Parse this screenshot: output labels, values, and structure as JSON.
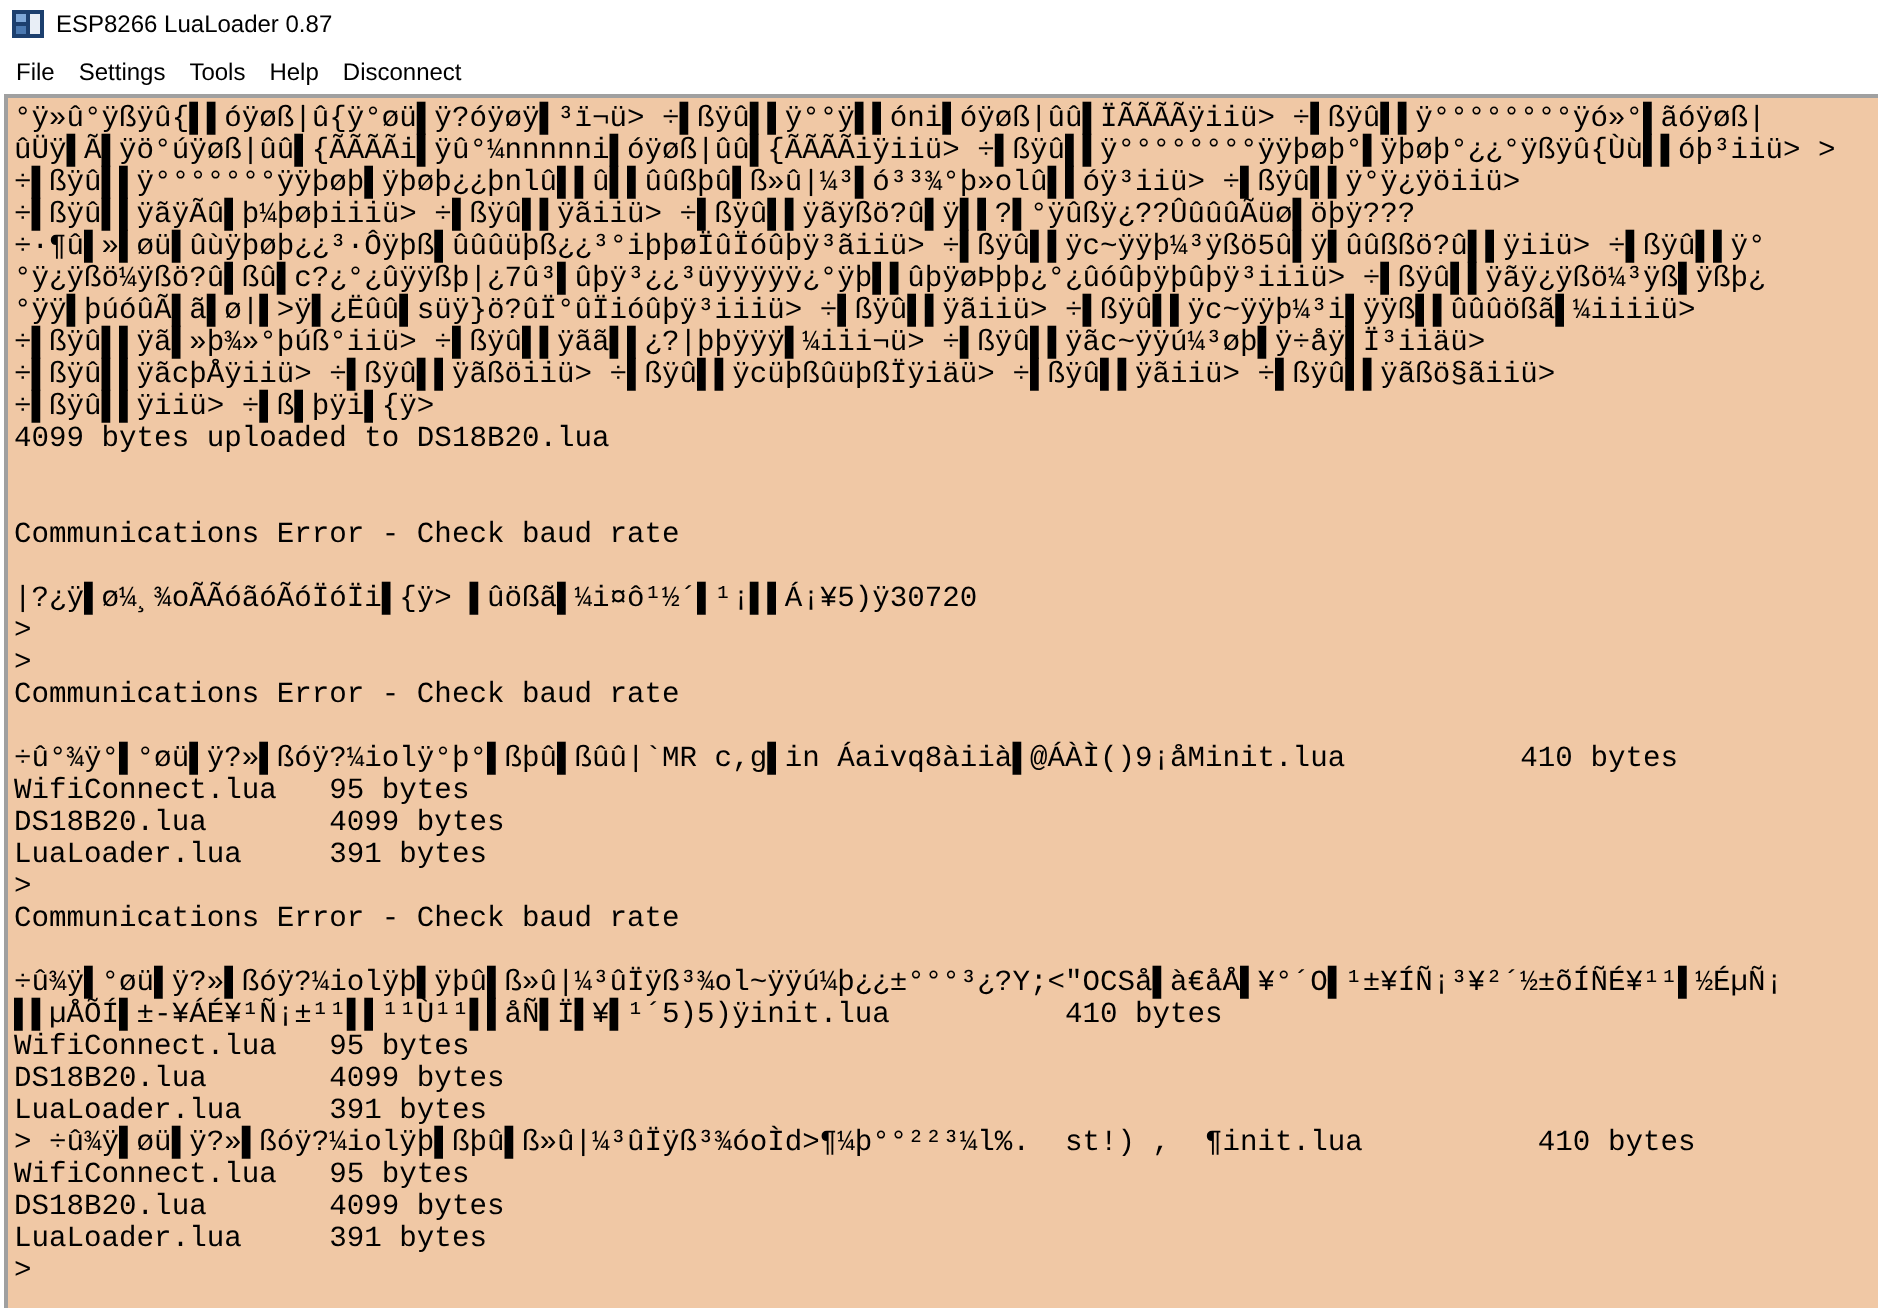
{
  "window": {
    "title": "ESP8266 LuaLoader 0.87"
  },
  "menu": [
    "File",
    "Settings",
    "Tools",
    "Help",
    "Disconnect"
  ],
  "console": {
    "lines": [
      {
        "kind": "text",
        "text": "°ÿ»û°ÿßÿû{▌▌óÿøß|û{ÿ°øü▌ÿ?óÿøÿ▌³ï¬ü> ÷▌ßÿû▌▌ÿ°°ÿ▌▌óni▌óÿøß|ûû▌ÏÃÃÃÃÿiiü> ÷▌ßÿû▌▌ÿ°°°°°°°°ÿó»°▌ãóÿøß|"
      },
      {
        "kind": "text",
        "text": "ûÜÿ▌Ã▌ÿö°úÿøß|ûû▌{ÃÃÃÃi▌ÿû°¼nnnnni▌óÿøß|ûû▌{ÃÃÃÃiÿiiü> ÷▌ßÿû▌▌ÿ°°°°°°°°ÿÿþøþ°▌ÿþøþ°¿¿°ÿßÿû{Ùù▌▌óþ³iiü> >"
      },
      {
        "kind": "text",
        "text": "÷▌ßÿû▌▌ÿ°°°°°°°ÿÿþøþ▌ÿþøþ¿¿þnlû▌▌û▌▌ûûßþû▌ß»û|¼³▌ó³³¾°þ»olû▌▌óÿ³iiü> ÷▌ßÿû▌▌ÿ°ÿ¿ÿöiiü>"
      },
      {
        "kind": "text",
        "text": "÷▌ßÿû▌▌ÿãÿÃû▌þ¼þøþiiiü> ÷▌ßÿû▌▌ÿãiiü> ÷▌ßÿû▌▌ÿãÿßö?û▌ÿ▌▌?▌°ÿûßÿ¿??ÛûûûÃüø▌öþÿ???"
      },
      {
        "kind": "text",
        "text": "÷·¶û▌»▌øü▌ûùÿþøþ¿¿³·Ôÿþß▌ûûûüþß¿¿³°iþþøÏûÏóûþÿ³ãiiü> ÷▌ßÿû▌▌ÿc~ÿÿþ¼³ÿßö5û▌ÿ▌ûûßßö?û▌▌ÿiiü> ÷▌ßÿû▌▌ÿ°"
      },
      {
        "kind": "text",
        "text": "°ÿ¿ÿßö¼ÿßö?û▌ßû▌c?¿°¿ûÿÿßþ|¿7û³▌ûþÿ³¿¿³üÿÿÿÿÿ¿°ÿþ▌▌ûþÿøÞþþ¿°¿ûóûþÿþûþÿ³iiiü> ÷▌ßÿû▌▌ÿãÿ¿ÿßö¼³ÿß▌ÿßþ¿"
      },
      {
        "kind": "text",
        "text": "°ÿÿ▌þúóûÃ▌ã▌ø|▌>ÿ▌¿Ëûû▌süÿ}ö?ûÏ°ûÏióûþÿ³iiiü> ÷▌ßÿû▌▌ÿãiiü> ÷▌ßÿû▌▌ÿc~ÿÿþ¼³i▌ÿÿß▌▌ûûûößã▌¼iiiiü>"
      },
      {
        "kind": "text",
        "text": "÷▌ßÿû▌▌ÿã▌»þ¾»°þúß°iiü> ÷▌ßÿû▌▌ÿãã▌▌¿?|þþÿÿÿ▌¼iii¬ü> ÷▌ßÿû▌▌ÿãc~ÿÿú¼³øþ▌ÿ÷åÿ▌Ï³iiäü>"
      },
      {
        "kind": "text",
        "text": "÷▌ßÿû▌▌ÿãcþÅÿiiü> ÷▌ßÿû▌▌ÿãßöiiü> ÷▌ßÿû▌▌ÿcüþßûüþßÏÿiäü> ÷▌ßÿû▌▌ÿãiiü> ÷▌ßÿû▌▌ÿãßö§ãiiü>"
      },
      {
        "kind": "text",
        "text": "÷▌ßÿû▌▌ÿiiü> ÷▌ß▌þÿi▌{ÿ>"
      },
      {
        "kind": "text",
        "text": "4099 bytes uploaded to DS18B20.lua"
      },
      {
        "kind": "blank"
      },
      {
        "kind": "blank"
      },
      {
        "kind": "text",
        "text": "Communications Error - Check baud rate"
      },
      {
        "kind": "blank"
      },
      {
        "kind": "text",
        "text": "|?¿ÿ▌ø¼¸¾oÃÃóãóÃóÏóÏi▌{ÿ> ▌ûößã▌¼i¤ô¹½´▌¹¡▌▌Á¡¥5)ÿ30720"
      },
      {
        "kind": "text",
        "text": ">"
      },
      {
        "kind": "text",
        "text": ">"
      },
      {
        "kind": "text",
        "text": "Communications Error - Check baud rate"
      },
      {
        "kind": "blank"
      },
      {
        "kind": "text",
        "text": "÷û°¾ÿ°▌°øü▌ÿ?»▌ßóÿ?¼iolÿ°þ°▌ßþû▌ßûû|`MR c,g▌in Áaivq8àiià▌@ÁÀÌ()9¡åMinit.lua          410 bytes"
      },
      {
        "kind": "text",
        "text": "WifiConnect.lua   95 bytes"
      },
      {
        "kind": "text",
        "text": "DS18B20.lua       4099 bytes"
      },
      {
        "kind": "text",
        "text": "LuaLoader.lua     391 bytes"
      },
      {
        "kind": "text",
        "text": ">"
      },
      {
        "kind": "text",
        "text": "Communications Error - Check baud rate"
      },
      {
        "kind": "blank"
      },
      {
        "kind": "text",
        "text": "÷û¾ÿ▌°øü▌ÿ?»▌ßóÿ?¼iolÿþ▌ÿþû▌ß»û|¼³ûÏÿß³¾ol~ÿÿú¼þ¿¿±°°°³¿?Y;<\"OCSå▌à€åÅ▌¥°´O▌¹±¥ÍÑ¡³¥²´½±õÍÑÉ¥¹¹▌½ÉµÑ¡"
      },
      {
        "kind": "text",
        "text": "▌▌µÅÕÍ▌±-¥ÁÉ¥¹Ñ¡±¹¹▌▌¹¹Ù¹¹▌▌åÑ▌Ï▌¥▌¹´5)5)ÿinit.lua          410 bytes"
      },
      {
        "kind": "text",
        "text": "WifiConnect.lua   95 bytes"
      },
      {
        "kind": "text",
        "text": "DS18B20.lua       4099 bytes"
      },
      {
        "kind": "text",
        "text": "LuaLoader.lua     391 bytes"
      },
      {
        "kind": "text",
        "text": "> ÷û¾ÿ▌øü▌ÿ?»▌ßóÿ?¼iolÿþ▌ßþû▌ß»û|¼³ûÏÿß³¾óoÌd>¶¼þ°°²²³¼l%.  st!) ,  ¶init.lua          410 bytes"
      },
      {
        "kind": "text",
        "text": "WifiConnect.lua   95 bytes"
      },
      {
        "kind": "text",
        "text": "DS18B20.lua       4099 bytes"
      },
      {
        "kind": "text",
        "text": "LuaLoader.lua     391 bytes"
      },
      {
        "kind": "text",
        "text": ">"
      }
    ]
  }
}
